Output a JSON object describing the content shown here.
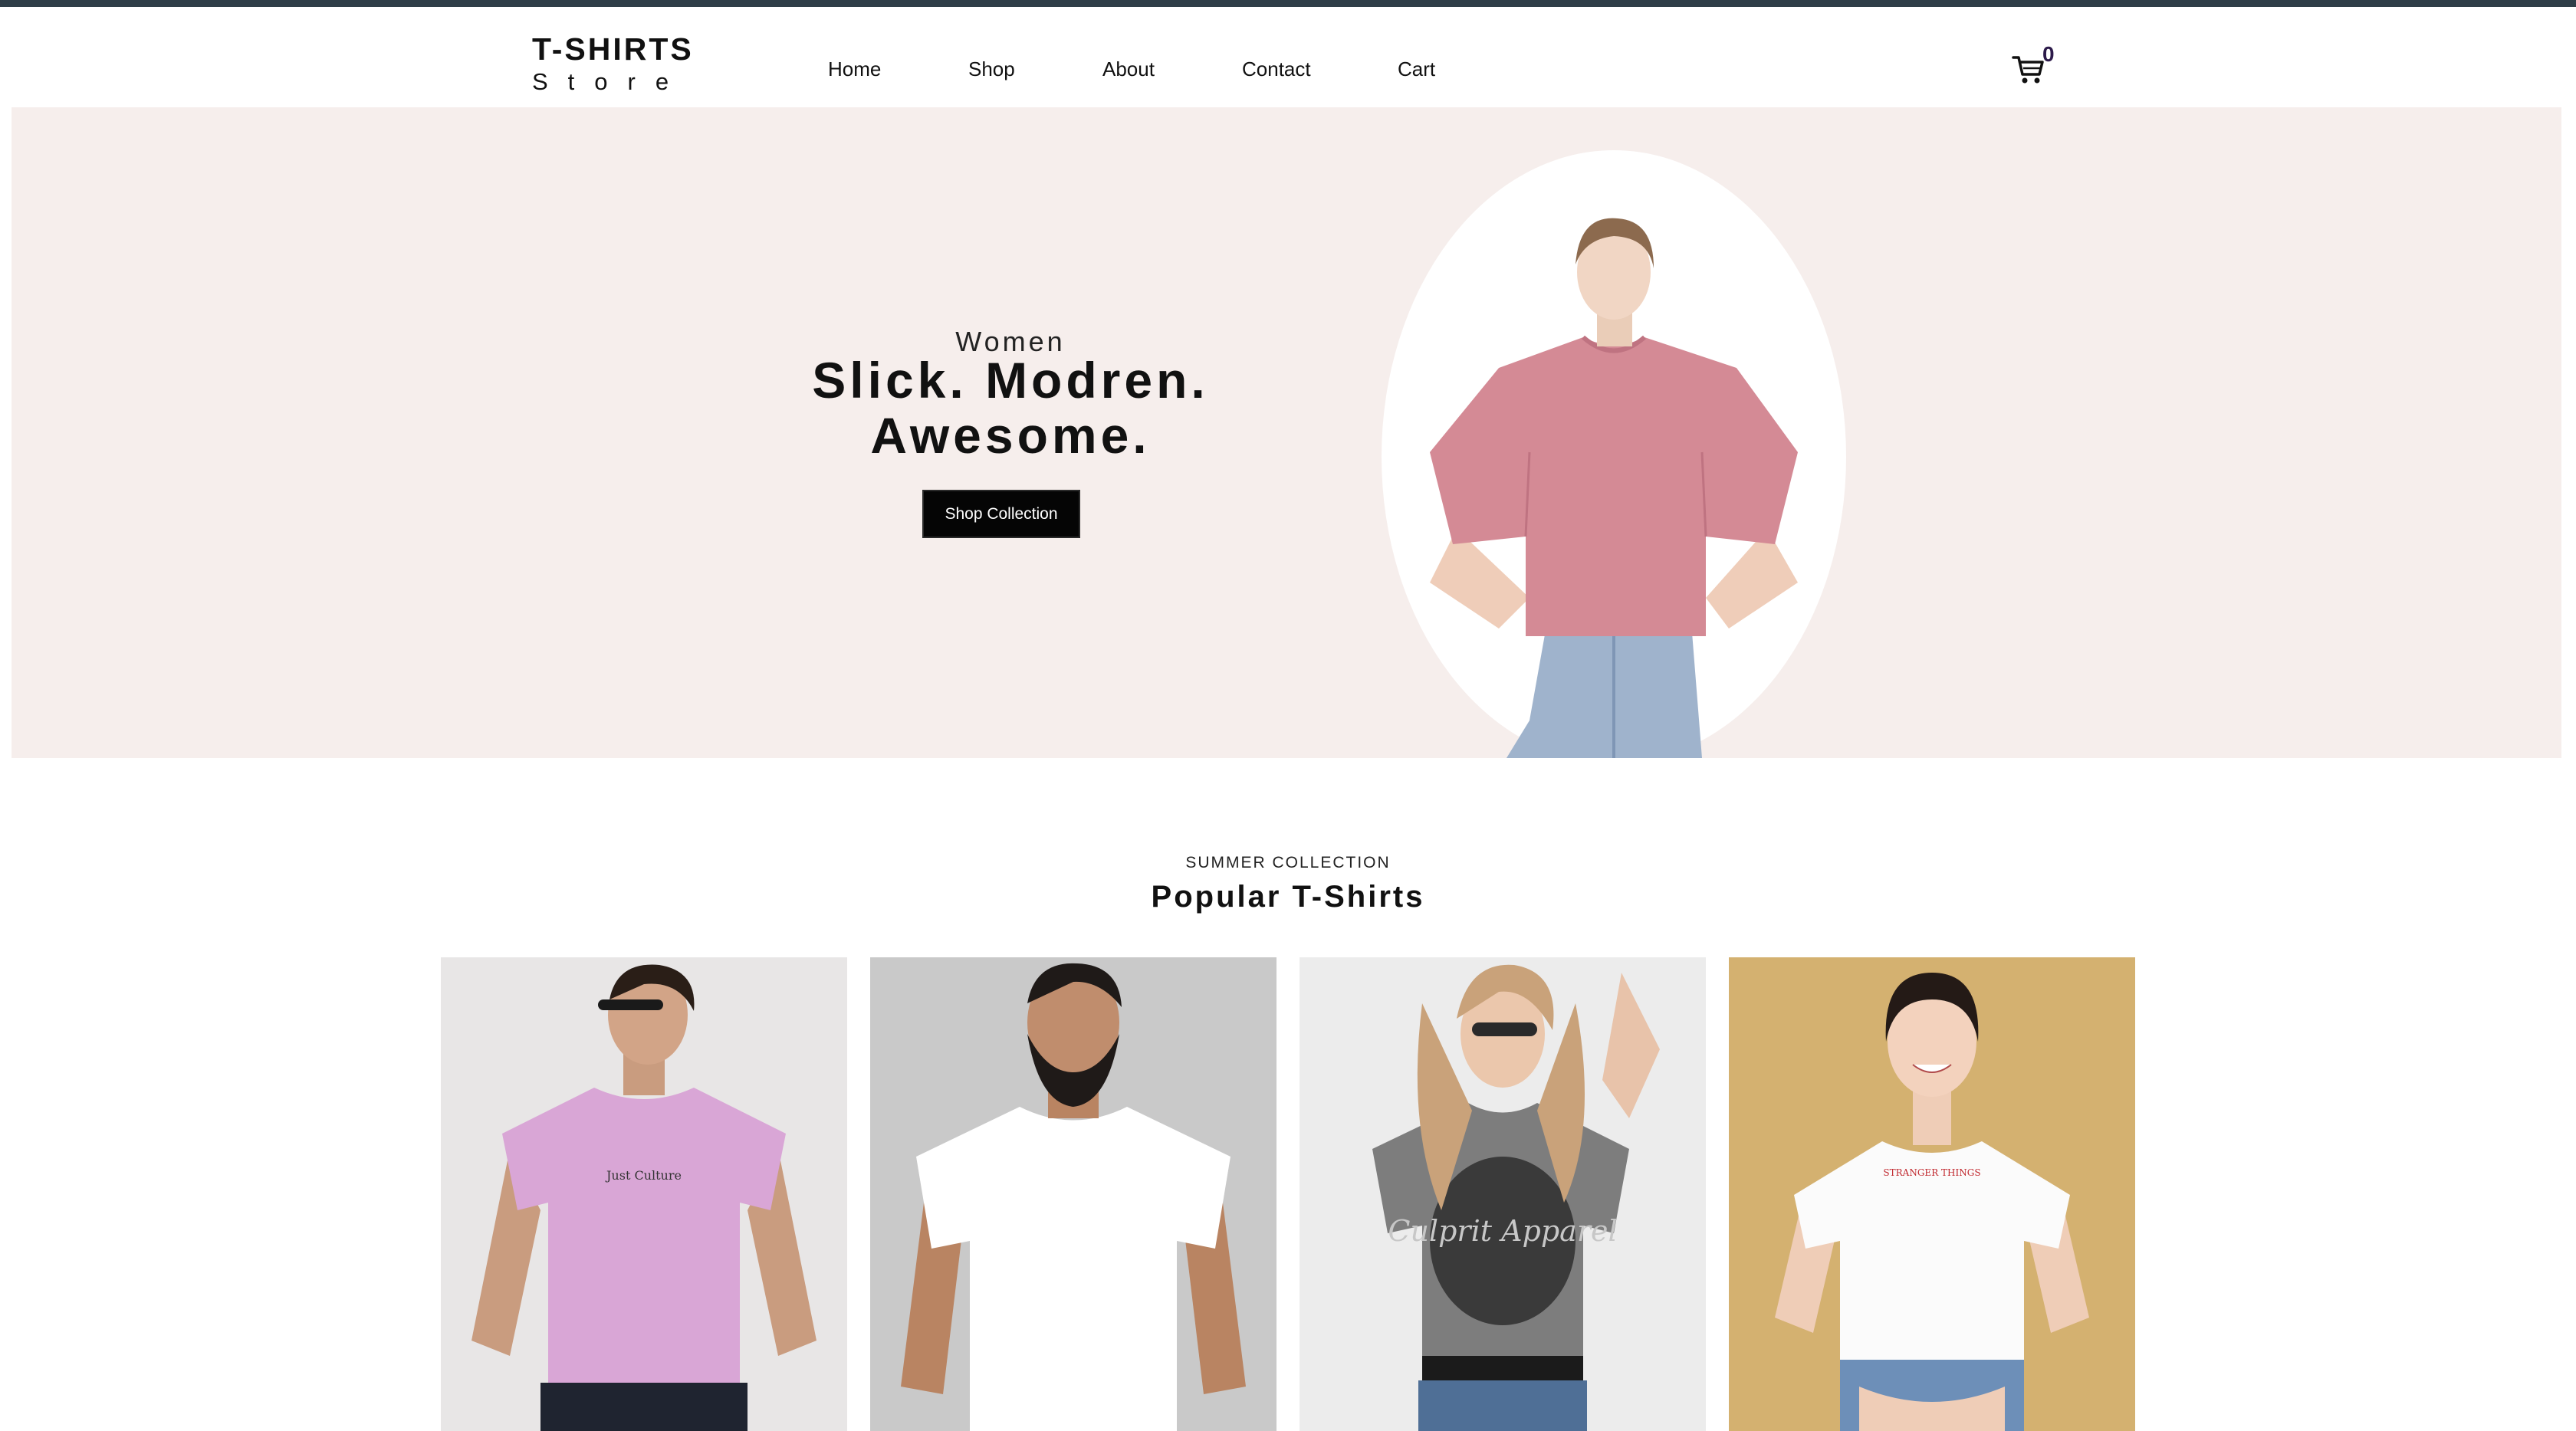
{
  "header": {
    "logo_title": "T-SHIRTS",
    "logo_subtitle": "Store",
    "nav": [
      "Home",
      "Shop",
      "About",
      "Contact",
      "Cart"
    ],
    "cart_count": "0",
    "cart_icon": "cart-icon"
  },
  "hero": {
    "eyebrow": "Women",
    "title_line1": "Slick. Modren.",
    "title_line2": "Awesome.",
    "cta": "Shop Collection",
    "background": "#f6eeec",
    "shirt_color": "#d48a95"
  },
  "collection": {
    "eyebrow": "SUMMER COLLECTION",
    "title": "Popular T-Shirts",
    "products": [
      {
        "photo": "man in pink t-shirt",
        "shirt_print": "Just Culture",
        "shirt_color": "#d9a6d6"
      },
      {
        "photo": "bearded man in white t-shirt",
        "shirt_color": "#ffffff"
      },
      {
        "photo": "woman in grey graphic t-shirt",
        "shirt_print": "Culprit Apparel",
        "shirt_color": "#7d7d7d"
      },
      {
        "photo": "smiling woman in white t-shirt",
        "shirt_print": "STRANGER THINGS",
        "shirt_color": "#fbfbfb"
      }
    ]
  }
}
